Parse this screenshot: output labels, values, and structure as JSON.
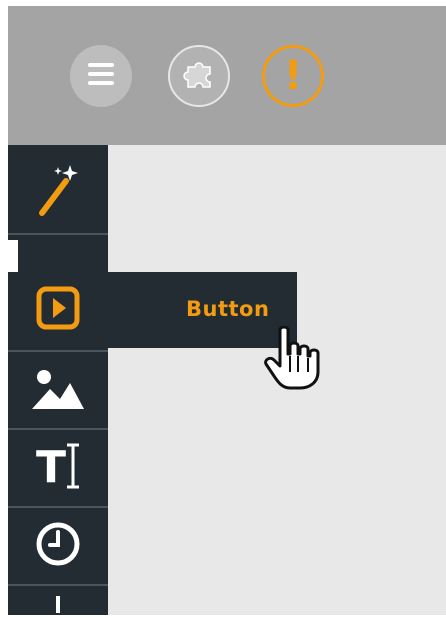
{
  "toolbar": {
    "buttons": [
      {
        "name": "menu",
        "icon": "hamburger-menu-icon"
      },
      {
        "name": "plugins",
        "icon": "puzzle-icon"
      },
      {
        "name": "alert",
        "icon": "exclamation-icon",
        "glyph": "!"
      }
    ]
  },
  "sidebar": {
    "tools": [
      {
        "icon": "magic-wand-icon"
      },
      {
        "icon": "button-widget-icon",
        "label": "Button",
        "active": true
      },
      {
        "icon": "image-icon"
      },
      {
        "icon": "text-icon",
        "glyph": "T"
      },
      {
        "icon": "clock-icon"
      }
    ]
  },
  "colors": {
    "accent": "#f39c12",
    "sidebar_bg": "#232c33",
    "topbar_bg": "#a4a4a4",
    "canvas_bg": "#e8e8e8"
  }
}
